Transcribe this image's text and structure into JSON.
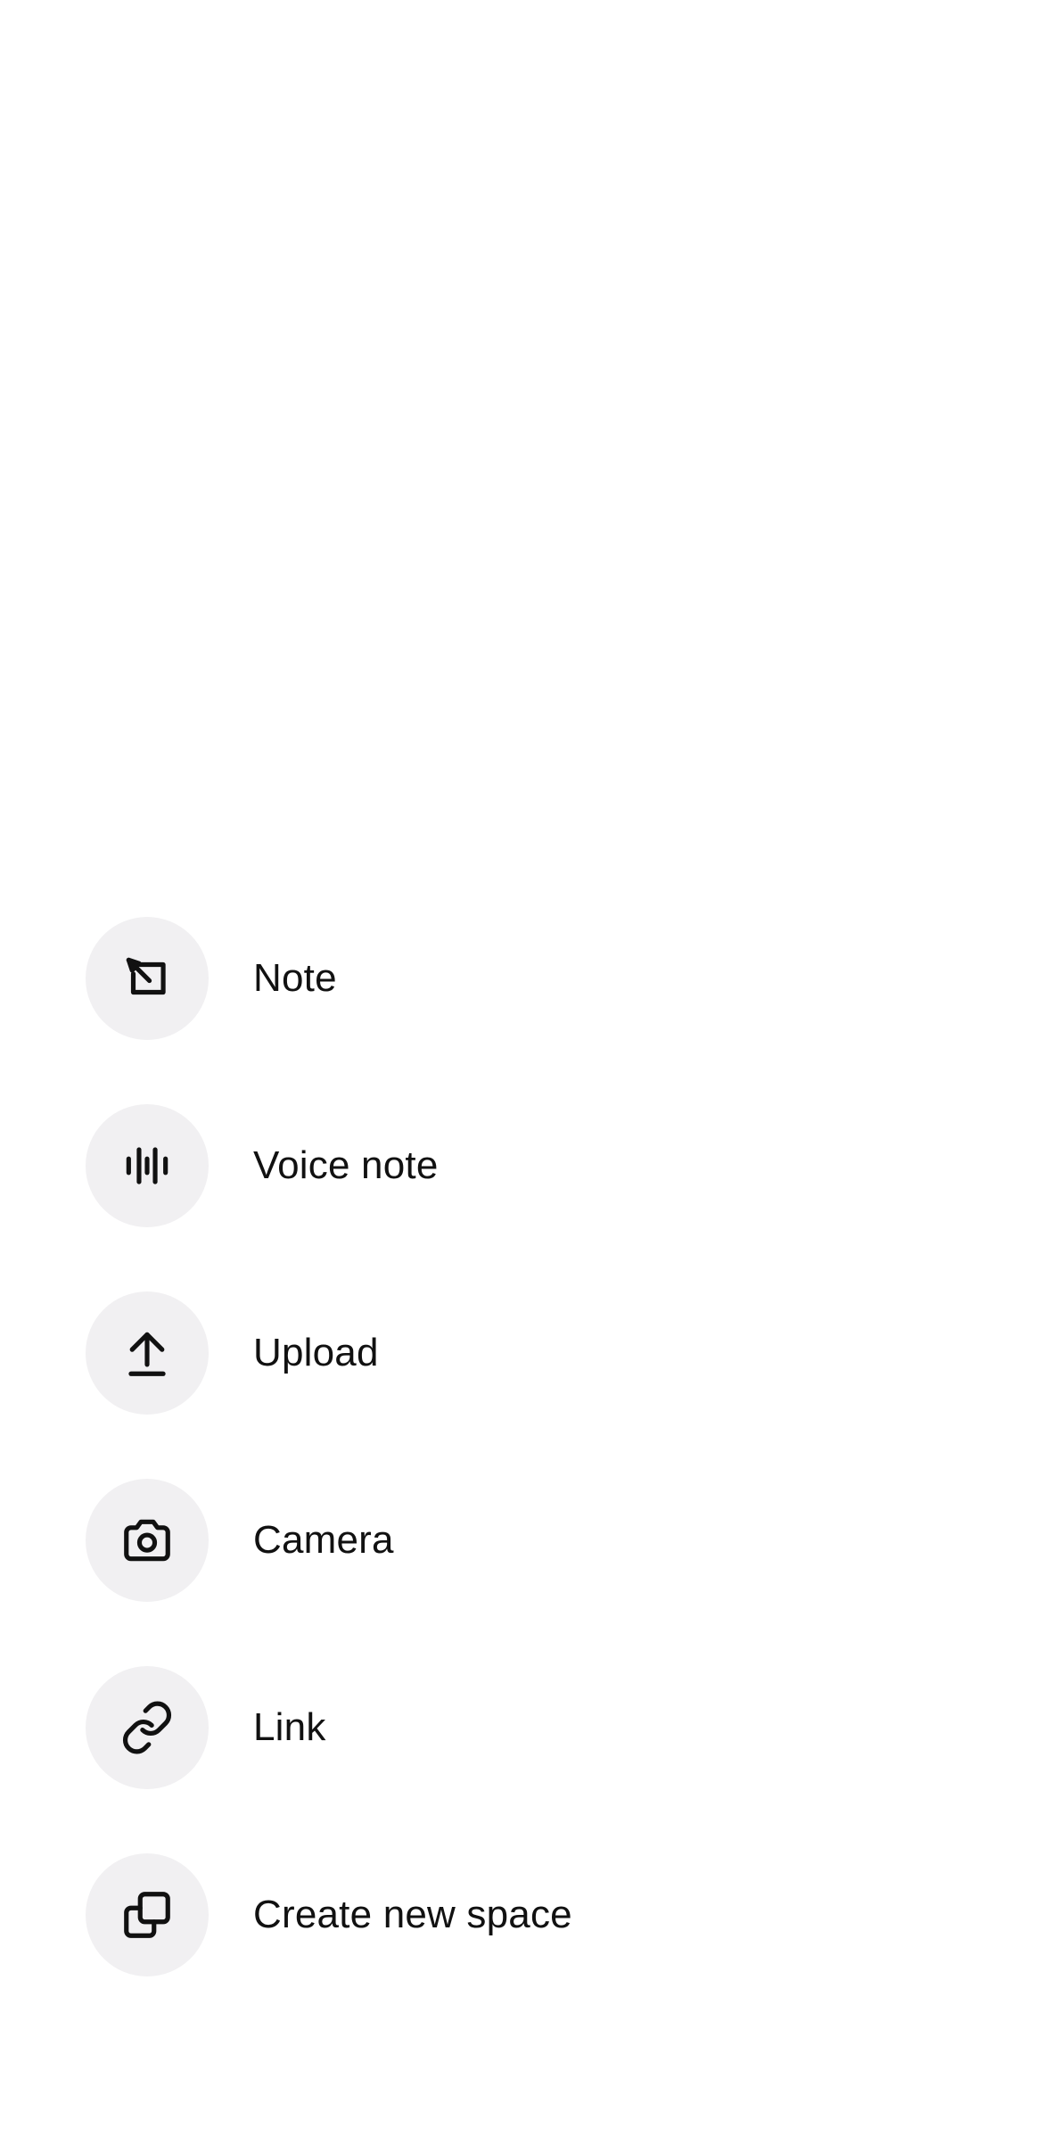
{
  "menu": {
    "items": [
      {
        "id": "note",
        "label": "Note",
        "icon": "note-edit-icon"
      },
      {
        "id": "voice-note",
        "label": "Voice note",
        "icon": "waveform-icon"
      },
      {
        "id": "upload",
        "label": "Upload",
        "icon": "upload-arrow-icon"
      },
      {
        "id": "camera",
        "label": "Camera",
        "icon": "camera-icon"
      },
      {
        "id": "link",
        "label": "Link",
        "icon": "link-icon"
      },
      {
        "id": "create-new-space",
        "label": "Create new space",
        "icon": "copy-stack-icon"
      }
    ]
  },
  "colors": {
    "background": "#ffffff",
    "icon_circle": "#f1f0f2",
    "text": "#111111",
    "icon_stroke": "#111111"
  }
}
